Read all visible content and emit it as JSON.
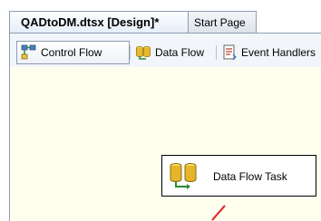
{
  "document_tabs": [
    {
      "label": "QADtoDM.dtsx [Design]*",
      "active": true
    },
    {
      "label": "Start Page",
      "active": false
    }
  ],
  "designer_tabs": [
    {
      "label": "Control Flow",
      "icon": "control-flow-icon",
      "active": true
    },
    {
      "label": "Data Flow",
      "icon": "data-flow-icon",
      "active": false
    },
    {
      "label": "Event Handlers",
      "icon": "event-handlers-icon",
      "active": false
    }
  ],
  "canvas": {
    "task": {
      "label": "Data Flow Task",
      "icon": "data-flow-task-icon"
    }
  },
  "colors": {
    "canvas_background": "#fffff0",
    "connector": "#e03030",
    "tab_border": "#8f9cb0"
  }
}
